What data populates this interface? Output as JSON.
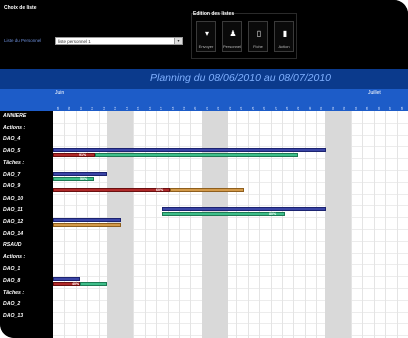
{
  "toolbar": {
    "list_group_title": "Choix de liste",
    "list_label": "Liste du Personnel",
    "list_value": "liste personnel 1",
    "edit_group_title": "Edition des listes",
    "buttons": [
      {
        "label": "Envoyer",
        "icon": "send-icon"
      },
      {
        "label": "Personnel",
        "icon": "person-icon"
      },
      {
        "label": "Fiche",
        "icon": "sheet-icon"
      },
      {
        "label": "Action",
        "icon": "action-icon"
      }
    ]
  },
  "planning": {
    "title": "Planning du 08/06/2010 au 08/07/2010",
    "months": [
      "Juin",
      "Juillet"
    ],
    "days": [
      "08",
      "09",
      "10",
      "11",
      "12",
      "13",
      "14",
      "15",
      "16",
      "17",
      "18",
      "19",
      "20",
      "21",
      "22",
      "23",
      "24",
      "25",
      "26",
      "27",
      "28",
      "29",
      "30",
      "01",
      "02",
      "03",
      "04",
      "05",
      "06",
      "07",
      "08"
    ]
  },
  "rows": [
    {
      "label": "ANNIERE"
    },
    {
      "label": "Actions :"
    },
    {
      "label": "DAO_4"
    },
    {
      "label": "DAO_5"
    },
    {
      "label": "Tâches :"
    },
    {
      "label": "DAO_7"
    },
    {
      "label": "DAO_9"
    },
    {
      "label": "DAO_10"
    },
    {
      "label": "DAO_11"
    },
    {
      "label": "DAO_12"
    },
    {
      "label": "DAO_14"
    },
    {
      "label": "RSAUD"
    },
    {
      "label": "Actions :"
    },
    {
      "label": "DAO_1"
    },
    {
      "label": "DAO_8"
    },
    {
      "label": "Tâches :"
    },
    {
      "label": "DAO_2"
    },
    {
      "label": "DAO_13"
    }
  ],
  "bars": [
    {
      "row": "DAO_5",
      "pct": "91%"
    },
    {
      "row": "DAO_7",
      "pct": "50%"
    },
    {
      "row": "DAO_9",
      "pct": "60%"
    },
    {
      "row": "DAO_11",
      "pct": "80%"
    },
    {
      "row": "DAO_8",
      "pct": "40%"
    }
  ]
}
